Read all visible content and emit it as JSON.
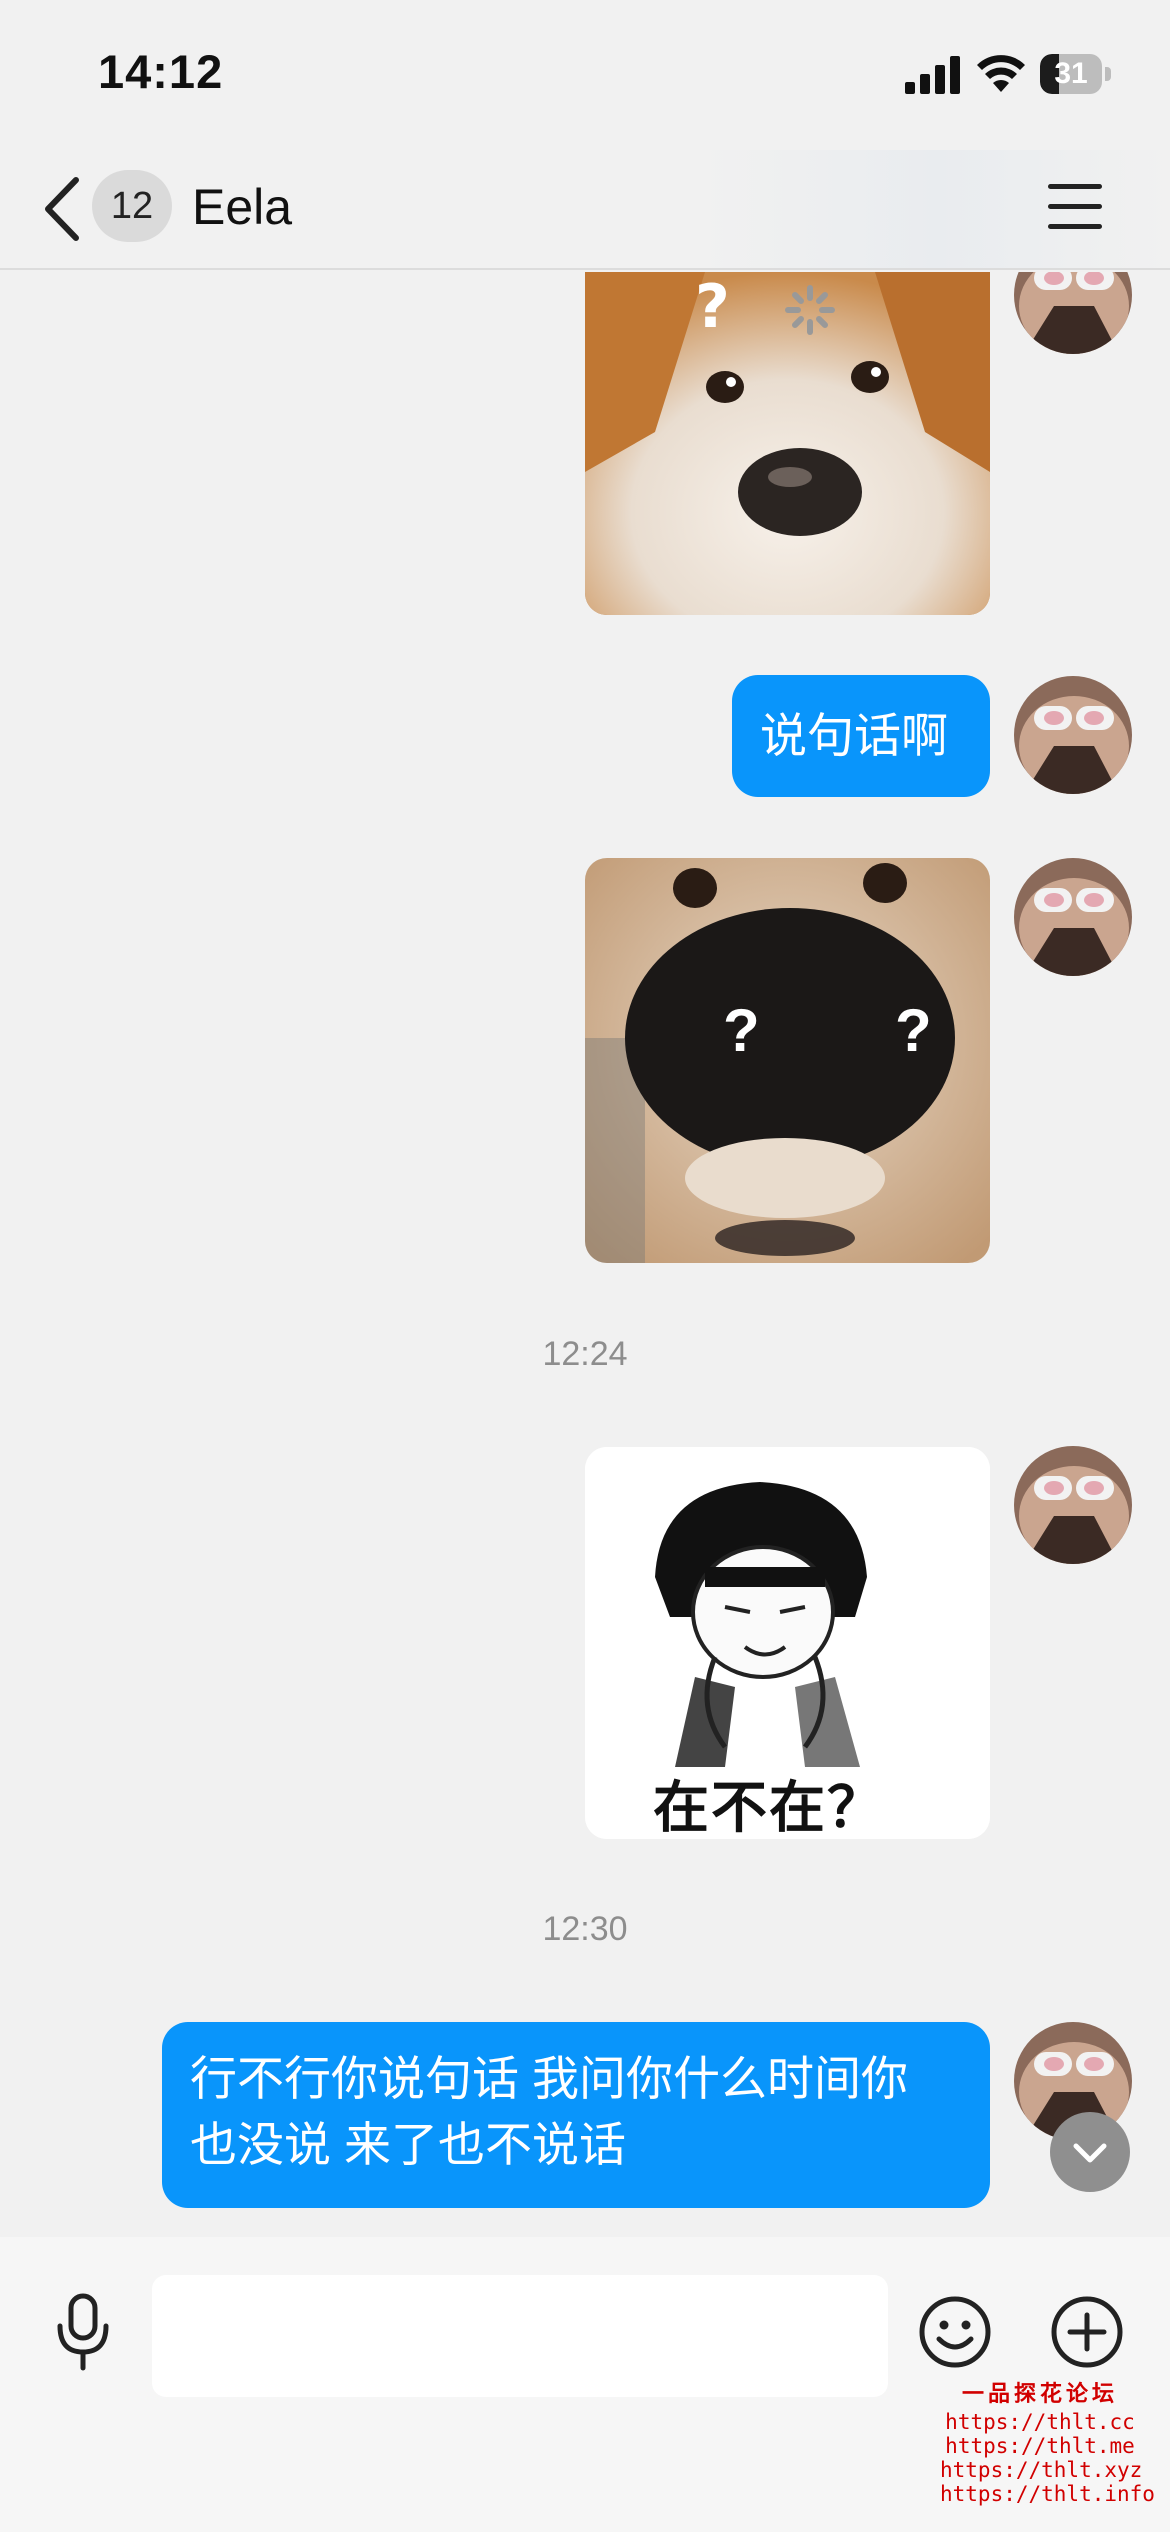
{
  "status_bar": {
    "time": "14:12",
    "battery": "31",
    "battery_level_percent": 31,
    "icons": [
      "cellular-signal-icon",
      "wifi-icon",
      "battery-icon"
    ]
  },
  "nav": {
    "back_icon": "chevron-left-icon",
    "unread_count": "12",
    "title": "Eela",
    "menu_icon": "hamburger-menu-icon"
  },
  "messages": [
    {
      "type": "image",
      "sender": "me",
      "description": "corgi-sticker"
    },
    {
      "type": "text",
      "sender": "me",
      "text": "说句话啊"
    },
    {
      "type": "image",
      "sender": "me",
      "description": "dog-nose-sticker",
      "overlay_text": [
        "?",
        "?"
      ]
    },
    {
      "type": "timestamp",
      "text": "12:24"
    },
    {
      "type": "image",
      "sender": "me",
      "description": "mushroom-head-meme-sticker",
      "caption": "在不在？"
    },
    {
      "type": "timestamp",
      "text": "12:30"
    },
    {
      "type": "text",
      "sender": "me",
      "lines": [
        "行不行你说句话 我问你什么时间你",
        "也没说 来了也不说话"
      ]
    }
  ],
  "scroll_down_icon": "chevron-down-icon",
  "input_bar": {
    "mic_icon": "microphone-icon",
    "input_value": "",
    "emoji_icon": "smiley-icon",
    "plus_icon": "plus-circle-icon"
  },
  "watermark": {
    "title": "一品探花论坛",
    "lines": [
      "https://thlt.cc",
      "https://thlt.me",
      "https://thlt.xyz",
      "https://thlt.info"
    ]
  },
  "colors": {
    "bubble": "#0995fb",
    "background": "#f1f1f1",
    "watermark": "#d10000"
  }
}
